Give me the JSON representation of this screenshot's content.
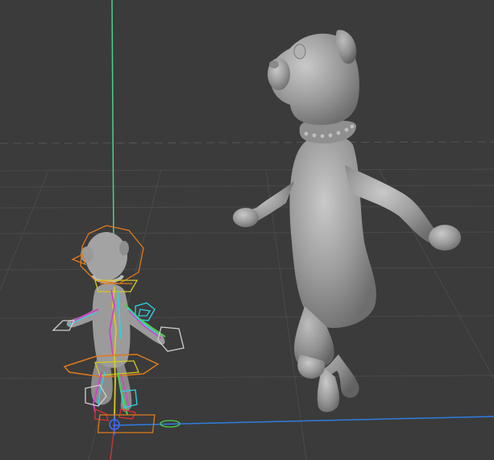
{
  "viewport": {
    "background": "#3b3b3b",
    "grid_color": "#4a4a4a",
    "axis_y_color": "#4fd08a",
    "axis_x_color": "#2f7de0",
    "axis_z_color": "#b83a3a"
  },
  "characters": [
    {
      "name": "rigged-dog-character",
      "role": "rigged model with animation controls",
      "mesh_color": "#9a9a9a"
    },
    {
      "name": "clay-dog-character",
      "role": "unrigged sculpt preview",
      "mesh_color": "#9c9c9c"
    }
  ],
  "rig_controls": {
    "colors": {
      "orange": "#e07a1a",
      "cyan": "#2fd3e6",
      "magenta": "#d043c8",
      "green": "#4ad04a",
      "yellow": "#d8c820",
      "white": "#cfcfcf",
      "red": "#e03030",
      "blue": "#3c6cff"
    }
  }
}
